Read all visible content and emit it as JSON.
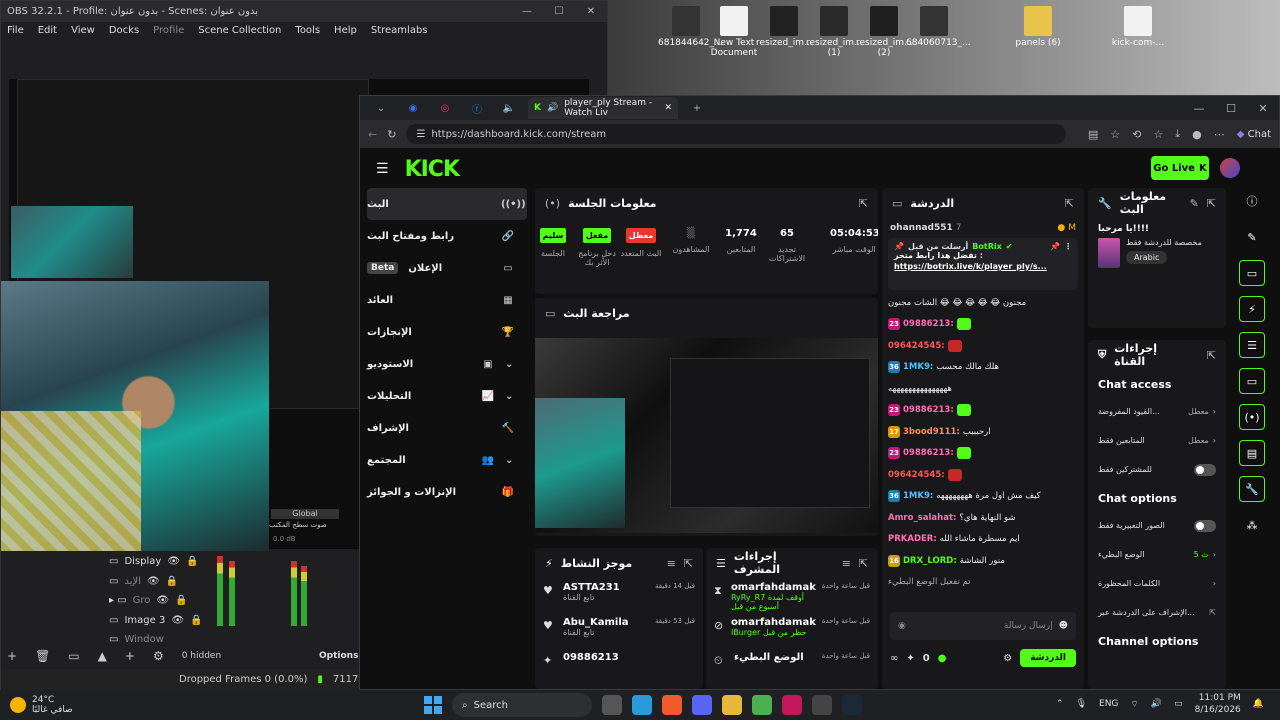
{
  "desktop": {
    "icons": [
      {
        "label": "681844642_..."
      },
      {
        "label": "New Text Document"
      },
      {
        "label": "resized_im..."
      },
      {
        "label": "resized_im... (1)"
      },
      {
        "label": "resized_im... (2)"
      },
      {
        "label": "684060713_..."
      },
      {
        "label": "panels (6)"
      },
      {
        "label": "kick-com-..."
      }
    ]
  },
  "obs": {
    "title": "OBS 32.2.1 - Profile: بدون عنوان - Scenes: بدون عنوان",
    "menu": [
      "File",
      "Edit",
      "View",
      "Docks",
      "Profile",
      "Scene Collection",
      "Tools",
      "Help",
      "Streamlabs"
    ],
    "sources": [
      "Display",
      "الإيد",
      "Gro",
      "Image 3",
      "Window"
    ],
    "mixer_global": "Global",
    "mixer_label": "صوت سطح المكتب",
    "mixer_db": "0.0 dB",
    "hidden_label": "0 hidden",
    "options_label": "Options",
    "dropped_frames": "Dropped Frames 0 (0.0%)",
    "bitrate": "7117 kbps"
  },
  "browser": {
    "tab_title": "player_ply Stream - Watch Liv",
    "url": "https://dashboard.kick.com/stream",
    "copilot_label": "Chat"
  },
  "kick": {
    "logo": "KICK",
    "go_live": "Go Live",
    "nav": [
      {
        "label": "البث",
        "icon": "broadcast-icon"
      },
      {
        "label": "رابط ومفتاح البث",
        "icon": "link-icon"
      },
      {
        "label": "الإعلان",
        "icon": "ad-icon",
        "beta": "Beta"
      },
      {
        "label": "العائد",
        "icon": "revenue-icon"
      },
      {
        "label": "الإنجازات",
        "icon": "trophy-icon"
      },
      {
        "label": "الاستوديو",
        "icon": "studio-icon"
      },
      {
        "label": "التحليلات",
        "icon": "analytics-icon"
      },
      {
        "label": "الإشراف",
        "icon": "moderation-icon"
      },
      {
        "label": "المجتمع",
        "icon": "community-icon"
      },
      {
        "label": "الإنزالات و الجوائز",
        "icon": "drops-icon"
      }
    ],
    "session": {
      "title": "معلومات الجلسة",
      "stats": [
        {
          "value": "05:04:53",
          "label": "الوقت مباشر"
        },
        {
          "value": "65",
          "label": "تجديد الاشتراكات"
        },
        {
          "value": "1,774",
          "label": "المتابعين"
        },
        {
          "value": "",
          "label": "المشاهدون"
        },
        {
          "tag": "معطل",
          "label": "البث المتعدد"
        },
        {
          "tag": "مفعل",
          "label": "دخل برنامج الأثر بك"
        },
        {
          "tag": "سليم",
          "label": "الجلسة"
        }
      ]
    },
    "review_title": "مراجعة البث",
    "activity": {
      "title": "موجز النشاط",
      "rows": [
        {
          "name": "ASTTA231",
          "sub": "تابع القناة",
          "time": "قبل 14 دقيقة"
        },
        {
          "name": "Abu_Kamila",
          "sub": "تابع القناة",
          "time": "قبل 53 دقيقة"
        },
        {
          "name": "09886213",
          "sub": "",
          "time": ""
        }
      ]
    },
    "modactions": {
      "title": "إجراءات المشرف",
      "rows": [
        {
          "name": "omarfahdamak",
          "sub": "RyRy_R7 أوقف لمدة أسبوع من قبل",
          "time": "قبل ساعة واحدة"
        },
        {
          "name": "omarfahdamak",
          "sub": "IBurger حظر من قبل",
          "time": "قبل ساعة واحدة"
        },
        {
          "name": "الوضع البطيء",
          "sub": "",
          "time": "قبل ساعة واحدة"
        }
      ]
    },
    "chat": {
      "title": "الدردشة",
      "top_user": "ohannad551",
      "top_count": "7",
      "pinned_by": "أرسلت من قبل",
      "pinned_bot": "BotRix",
      "pinned_text": "تفضل هذا رابط متجر :",
      "pinned_link": "https://botrix.live/k/player_ply/s...",
      "messages": [
        {
          "user": "",
          "text": "مجنون 😂 😂 😂 😂 😂 الشات مجنون",
          "color": "#eee"
        },
        {
          "user": "09886213:",
          "text": "",
          "color": "#ff6fb5",
          "badge": "23",
          "badge_color": "#c2187a"
        },
        {
          "user": "096424545:",
          "text": "",
          "color": "#ff5555",
          "badge": "",
          "badge_color": ""
        },
        {
          "user": "1MK9:",
          "text": "هلك مالك محسب",
          "color": "#4fc3ff",
          "badge": "36",
          "badge_color": "#1a7fb5"
        },
        {
          "user": "",
          "text": "هههههههههههههههه",
          "color": "#eee"
        },
        {
          "user": "09886213:",
          "text": "",
          "color": "#ff6fb5",
          "badge": "23",
          "badge_color": "#c2187a"
        },
        {
          "user": "3bood9111:",
          "text": "ارحبببب",
          "color": "#ff8a5c",
          "badge": "17",
          "badge_color": "#d69a00"
        },
        {
          "user": "09886213:",
          "text": "",
          "color": "#ff6fb5",
          "badge": "23",
          "badge_color": "#c2187a"
        },
        {
          "user": "096424545:",
          "text": "",
          "color": "#ff5555",
          "badge": "",
          "badge_color": ""
        },
        {
          "user": "1MK9:",
          "text": "كيف مش اول مرة ههههههههه",
          "color": "#4fc3ff",
          "badge": "36",
          "badge_color": "#1a7fb5"
        },
        {
          "user": "Amro_salahat:",
          "text": "شو النهاية هاي؟",
          "color": "#ff6fb5",
          "badge": "",
          "badge_color": ""
        },
        {
          "user": "PRKADER:",
          "text": "ايم مسطرة ماشاء الله",
          "color": "#ff6fb5",
          "badge": "",
          "badge_color": ""
        },
        {
          "user": "DRX_LORD:",
          "text": "منور الشاشة",
          "color": "#53fc18",
          "badge": "16",
          "badge_color": "#c9a100"
        },
        {
          "user": "",
          "text": "تم تفعيل الوضع البطيء",
          "color": "#aaa"
        }
      ],
      "input_placeholder": "إرسال رسالة",
      "points": "0",
      "send_label": "الدردشة"
    },
    "info": {
      "title": "معلومات البث",
      "greeting": "يا مرحبا!!!!",
      "category": "مخصصة للدردشة فقط",
      "language": "Arabic"
    },
    "channel": {
      "title": "إجراءات القناة",
      "chat_access_title": "Chat access",
      "chat_access_rows": [
        {
          "label": "القيود المفروضة...",
          "value": "معطل"
        },
        {
          "label": "المتابعين فقط",
          "value": "معطل"
        },
        {
          "label": "للمشتركين فقط",
          "value": ""
        }
      ],
      "chat_options_title": "Chat options",
      "chat_options_rows": [
        {
          "label": "الصور التعبيرية فقط",
          "value": ""
        },
        {
          "label": "الوضع البطيء",
          "value": "5 ث"
        },
        {
          "label": "الكلمات المحظورة",
          "value": ""
        },
        {
          "label": "الإشراف على الدردشة عبر...",
          "value": ""
        }
      ],
      "channel_options_title": "Channel options"
    }
  },
  "taskbar": {
    "temp": "24°C",
    "weather": "صافي غالبًا",
    "search": "Search",
    "lang": "ENG",
    "time": "11:01 PM",
    "date": "8/16/2026"
  },
  "colors": {
    "kick_green": "#53fc18",
    "panel": "#18181b",
    "bg": "#0f0f10"
  }
}
